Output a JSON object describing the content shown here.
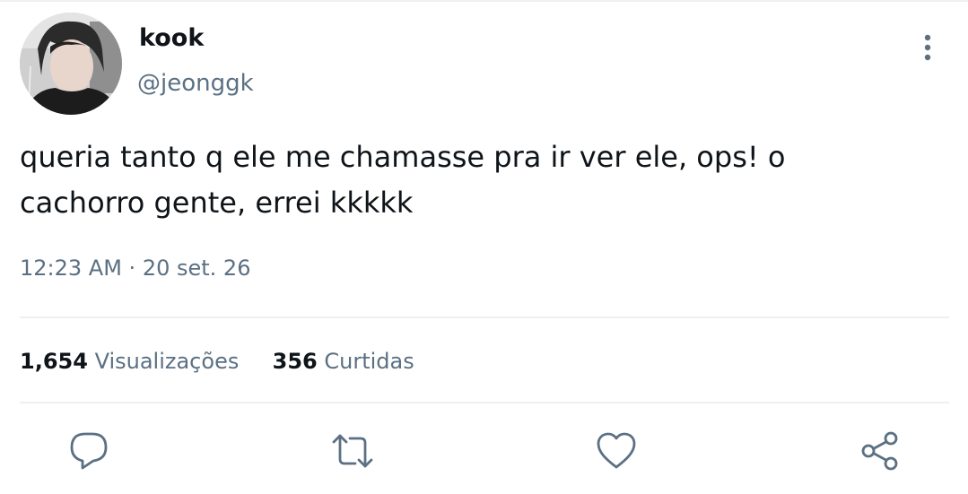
{
  "tweet": {
    "author": {
      "display_name": "kook",
      "handle": "@jeonggk"
    },
    "text": "queria tanto q ele me chamasse pra ir ver ele, ops! o\ncachorro gente, errei kkkkk",
    "time": "12:23 AM",
    "date": "20 set. 26",
    "stats": {
      "views_count": "1,654",
      "views_label": "Visualizações",
      "likes_count": "356",
      "likes_label": "Curtidas"
    }
  },
  "icons": {
    "more": "more-vertical-icon",
    "reply": "reply-icon",
    "retweet": "retweet-icon",
    "like": "heart-icon",
    "share": "share-icon"
  },
  "colors": {
    "text_primary": "#0f1419",
    "text_secondary": "#5b7083",
    "divider": "#eef0f1",
    "icon": "#5b7083"
  }
}
